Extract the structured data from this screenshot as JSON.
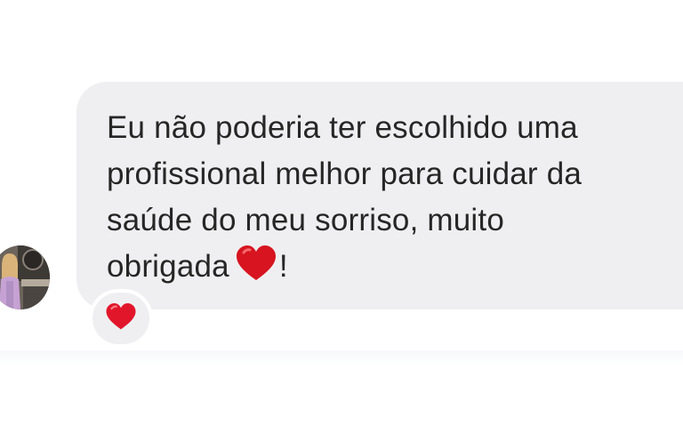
{
  "message": {
    "lines": [
      "Eu não poderia ter escolhido uma",
      "profissional melhor para cuidar da",
      "saúde do meu sorriso, muito"
    ],
    "last_line_text": "obrigada",
    "last_line_suffix": "!",
    "inline_emoji": "red-heart-icon"
  },
  "reaction": {
    "emoji": "red-heart-icon"
  },
  "colors": {
    "bubble_background": "#efeff1",
    "text": "#262626",
    "heart": "#d7141f"
  }
}
